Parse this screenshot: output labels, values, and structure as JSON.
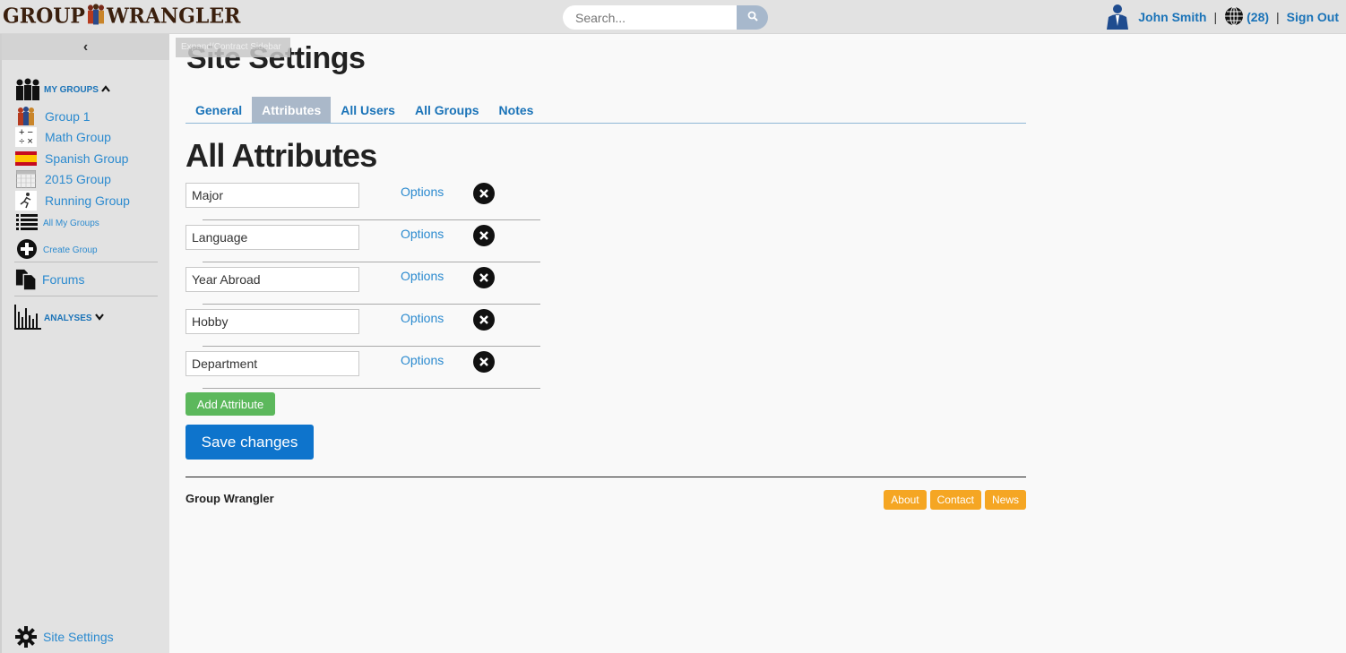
{
  "header": {
    "logo_left": "GROUP",
    "logo_right": "WRANGLER",
    "search_placeholder": "Search...",
    "user_name": "John Smith",
    "notification_count": "(28)",
    "sign_out": "Sign Out",
    "separator": "|"
  },
  "sidebar": {
    "collapse_glyph": "‹",
    "tooltip": "Expand/Contract Sidebar",
    "my_groups_label": "MY GROUPS",
    "groups": [
      {
        "label": "Group 1",
        "icon": "people-icon"
      },
      {
        "label": "Math Group",
        "icon": "math-symbols-icon"
      },
      {
        "label": "Spanish Group",
        "icon": "spain-flag-icon"
      },
      {
        "label": "2015 Group",
        "icon": "calendar-icon"
      },
      {
        "label": "Running Group",
        "icon": "runner-icon"
      }
    ],
    "all_my_groups": "All My Groups",
    "create_group": "Create Group",
    "forums": "Forums",
    "analyses_label": "ANALYSES",
    "site_settings": "Site Settings"
  },
  "main": {
    "page_title": "Site Settings",
    "tabs": [
      {
        "label": "General",
        "active": false
      },
      {
        "label": "Attributes",
        "active": true
      },
      {
        "label": "All Users",
        "active": false
      },
      {
        "label": "All Groups",
        "active": false
      },
      {
        "label": "Notes",
        "active": false
      }
    ],
    "section_title": "All Attributes",
    "attributes": [
      {
        "value": "Major",
        "options_label": "Options"
      },
      {
        "value": "Language",
        "options_label": "Options"
      },
      {
        "value": "Year Abroad",
        "options_label": "Options"
      },
      {
        "value": "Hobby",
        "options_label": "Options"
      },
      {
        "value": "Department",
        "options_label": "Options"
      }
    ],
    "add_attribute": "Add Attribute",
    "save_changes": "Save changes"
  },
  "footer": {
    "brand": "Group Wrangler",
    "links": [
      "About",
      "Contact",
      "News"
    ]
  },
  "colors": {
    "link": "#2b8acf",
    "active_tab": "#aab8c9",
    "add_button": "#5cb85c",
    "save_button": "#0e74cc",
    "footer_link": "#f5a623"
  }
}
